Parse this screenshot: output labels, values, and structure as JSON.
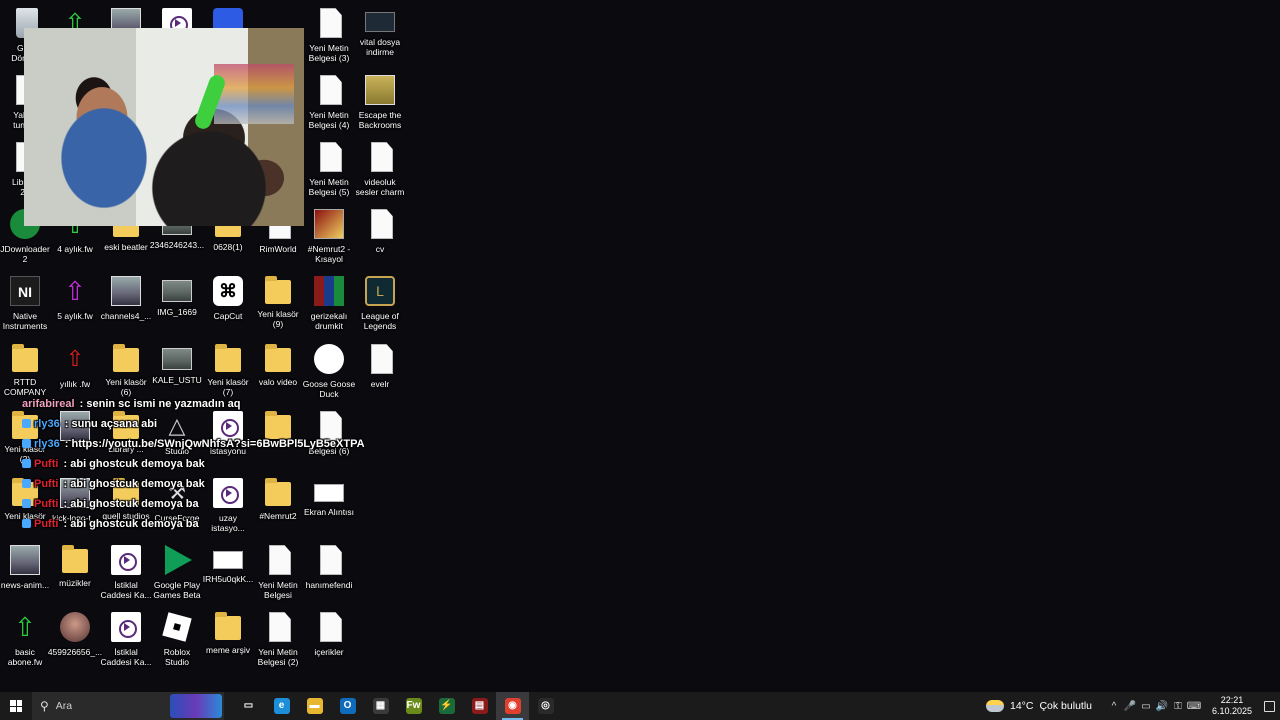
{
  "desktop": {
    "icons": [
      {
        "label": "Geri\nDönü...",
        "glyph": "recycle"
      },
      {
        "label": "",
        "glyph": "arrow-green"
      },
      {
        "label": "",
        "glyph": "photo2"
      },
      {
        "label": "",
        "glyph": "video"
      },
      {
        "label": "",
        "glyph": "blue"
      },
      {
        "label": "Yeni Metin\nBelgesi (3)",
        "glyph": "doc"
      },
      {
        "label": "vital dosya\nindirme",
        "glyph": "terminal"
      },
      {
        "label": "Yakup\ntung...",
        "glyph": "doc"
      },
      {
        "label": "Yeni Metin\nBelgesi (4)",
        "glyph": "doc"
      },
      {
        "label": "Escape the\nBackrooms",
        "glyph": "escape"
      },
      {
        "label": "Libre...\n25",
        "glyph": "doc"
      },
      {
        "label": "Yeni Metin\nBelgesi (5)",
        "glyph": "doc"
      },
      {
        "label": "videoluk\nsesler charm",
        "glyph": "doc"
      },
      {
        "label": "JDownloader\n2",
        "glyph": "download"
      },
      {
        "label": "4 aylık.fw",
        "glyph": "arrow-green"
      },
      {
        "label": "eski beatler",
        "glyph": "folder"
      },
      {
        "label": "2346246243...",
        "glyph": "photo"
      },
      {
        "label": "0628(1)",
        "glyph": "folder"
      },
      {
        "label": "RimWorld",
        "glyph": "doc"
      },
      {
        "label": "#Nemrut2 -\nKısayol",
        "glyph": "nemrut"
      },
      {
        "label": "cv",
        "glyph": "doc"
      },
      {
        "label": "Native\nInstruments",
        "glyph": "ni"
      },
      {
        "label": "5 aylık.fw",
        "glyph": "arrow-purple"
      },
      {
        "label": "channels4_...",
        "glyph": "photo2"
      },
      {
        "label": "IMG_1669",
        "glyph": "photo"
      },
      {
        "label": "CapCut",
        "glyph": "capcut"
      },
      {
        "label": "Yeni klasör\n(9)",
        "glyph": "folder"
      },
      {
        "label": "gerizekalı\ndrumkit",
        "glyph": "winrar"
      },
      {
        "label": "League of\nLegends",
        "glyph": "lol"
      },
      {
        "label": "RTTD\nCOMPANY",
        "glyph": "folder"
      },
      {
        "label": "yıllık .fw",
        "glyph": "arrow-red"
      },
      {
        "label": "Yeni klasör\n(6)",
        "glyph": "folder"
      },
      {
        "label": "KALE_USTU",
        "glyph": "photo"
      },
      {
        "label": "Yeni klasör\n(7)",
        "glyph": "folder"
      },
      {
        "label": "valo video",
        "glyph": "folder"
      },
      {
        "label": "Goose Goose\nDuck",
        "glyph": "goose"
      },
      {
        "label": "evelr",
        "glyph": "doc"
      },
      {
        "label": "Yeni klasör\n(2)",
        "glyph": "folder"
      },
      {
        "label": "",
        "glyph": "photo2"
      },
      {
        "label": "Library ...",
        "glyph": "folder"
      },
      {
        "label": "Studio",
        "glyph": "tri"
      },
      {
        "label": "istasyonu",
        "glyph": "video"
      },
      {
        "label": "",
        "glyph": "folder"
      },
      {
        "label": "Belgesi (6)",
        "glyph": "doc"
      },
      {
        "label": "Yeni klasör",
        "glyph": "folder"
      },
      {
        "label": "kick-logo-t...",
        "glyph": "photo2"
      },
      {
        "label": "quell studios",
        "glyph": "folder"
      },
      {
        "label": "CurseForge",
        "glyph": "curse"
      },
      {
        "label": "uzay\nistasyo...",
        "glyph": "video"
      },
      {
        "label": "#Nemrut2",
        "glyph": "folder"
      },
      {
        "label": "Ekran Alıntısı",
        "glyph": "screen"
      },
      {
        "label": "news-anim...",
        "glyph": "photo2"
      },
      {
        "label": "müzikler",
        "glyph": "folder"
      },
      {
        "label": "İstiklal\nCaddesi Ka...",
        "glyph": "video"
      },
      {
        "label": "Google Play\nGames Beta",
        "glyph": "gplay"
      },
      {
        "label": "IRH5u0qkK...",
        "glyph": "screen"
      },
      {
        "label": "Yeni Metin\nBelgesi",
        "glyph": "doc"
      },
      {
        "label": "hanımefendi",
        "glyph": "doc"
      },
      {
        "label": "basic\nabone.fw",
        "glyph": "arrow-green"
      },
      {
        "label": "459926656_...",
        "glyph": "avatar"
      },
      {
        "label": "İstiklal\nCaddesi Ka...",
        "glyph": "video"
      },
      {
        "label": "Roblox\nStudio",
        "glyph": "roblox"
      },
      {
        "label": "meme arşiv",
        "glyph": "folder"
      },
      {
        "label": "Yeni Metin\nBelgesi (2)",
        "glyph": "doc"
      },
      {
        "label": "içerikler",
        "glyph": "doc"
      }
    ]
  },
  "chat": [
    {
      "user": "arifabireal",
      "text": " : senin sc ismi ne yazmadın aq",
      "color": "#f0a0c0",
      "badge": ""
    },
    {
      "user": "rly36",
      "text": " : sunu açsana abi",
      "color": "#4aa8ff",
      "badge": "#4aa8ff"
    },
    {
      "user": "rly36",
      "text": " : https://youtu.be/SWnjQwNhfsA?si=6BwBPl5LyB5eXTPA",
      "color": "#4aa8ff",
      "badge": "#4aa8ff"
    },
    {
      "user": "Pufti",
      "text": " : abi ghostcuk demoya bak",
      "color": "#e02030",
      "badge": "#4aa8ff"
    },
    {
      "user": "Pufti",
      "text": " : abi ghostcuk demoya bak",
      "color": "#e02030",
      "badge": "#4aa8ff"
    },
    {
      "user": "Pufti",
      "text": " : abi ghostcuk demoya ba",
      "color": "#e02030",
      "badge": "#4aa8ff"
    },
    {
      "user": "Pufti",
      "text": " : abi ghostcuk demoya ba",
      "color": "#e02030",
      "badge": "#4aa8ff"
    }
  ],
  "taskbar": {
    "search_placeholder": "Ara",
    "apps": [
      {
        "name": "task-view",
        "glyph": "▭",
        "color": "transparent",
        "active": false
      },
      {
        "name": "edge",
        "glyph": "e",
        "color": "#1d8fd8",
        "active": false
      },
      {
        "name": "file-explorer",
        "glyph": "▬",
        "color": "#e8b730",
        "active": false
      },
      {
        "name": "outlook",
        "glyph": "O",
        "color": "#0f6cbd",
        "active": false
      },
      {
        "name": "store",
        "glyph": "▦",
        "color": "#3a3a3a",
        "active": false
      },
      {
        "name": "fireworks",
        "glyph": "Fw",
        "color": "#6a8a1a",
        "active": false
      },
      {
        "name": "flashpoint",
        "glyph": "⚡",
        "color": "#1a6a3a",
        "active": false
      },
      {
        "name": "winrar",
        "glyph": "▤",
        "color": "#8b1a1a",
        "active": false
      },
      {
        "name": "chrome",
        "glyph": "◉",
        "color": "#e04030",
        "active": true
      },
      {
        "name": "obs",
        "glyph": "◎",
        "color": "#2a2a2a",
        "active": false
      }
    ],
    "weather": {
      "temp": "14°C",
      "desc": "Çok bulutlu"
    },
    "tray_icons": [
      "^",
      "🎤",
      "▭",
      "🔊",
      "⚿",
      "⌨"
    ],
    "clock": {
      "time": "22:21",
      "date": "6.10.2025"
    }
  }
}
